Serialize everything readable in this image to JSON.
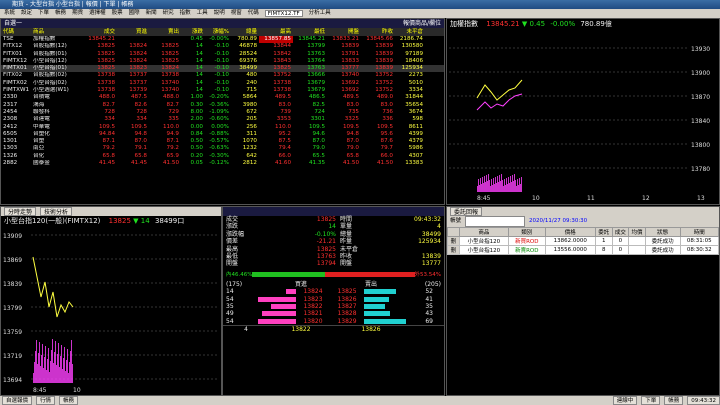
{
  "window": {
    "title": "期貨 - 大型台指 小型台指 | 報價 | 下單 | 帳務"
  },
  "menubar": {
    "items": [
      "系統",
      "設定",
      "下單",
      "帳務",
      "期貨",
      "選擇權",
      "股票",
      "國際",
      "新聞",
      "研究",
      "指數",
      "工具",
      "說明",
      "視窗"
    ],
    "symbol_label": "代碼",
    "symbol_value": "FIMTX12.TF",
    "analysis_label": "分析工具"
  },
  "quote": {
    "title": "自選一",
    "subtitle": "報價商品/欄位",
    "headers": [
      "代碼",
      "商品",
      "成交",
      "買進",
      "賣出",
      "漲跌",
      "漲幅%",
      "總量",
      "最高",
      "最低",
      "開盤",
      "昨收",
      "未平倉"
    ],
    "rows": [
      [
        "TSE",
        "加權指數",
        "13845.21",
        "",
        "",
        "0.45",
        "-0.00%",
        "780.89",
        "13857.85",
        "13845.21",
        "13833.21",
        "13845.66",
        "2186.74"
      ],
      [
        "FITX12",
        "台股指數(12)",
        "13825",
        "13824",
        "13825",
        "14",
        "-0.10",
        "46878",
        "13844",
        "13799",
        "13839",
        "13839",
        "130580"
      ],
      [
        "FITX01",
        "台股指數(01)",
        "13825",
        "13824",
        "13825",
        "14",
        "-0.10",
        "28524",
        "13842",
        "13763",
        "13781",
        "13839",
        "97189"
      ],
      [
        "FIMTX12",
        "小型台指(12)",
        "13825",
        "13824",
        "13825",
        "14",
        "-0.10",
        "69376",
        "13843",
        "13764",
        "13833",
        "13839",
        "18406"
      ],
      [
        "FIMTX01",
        "小型台指(01)",
        "13825",
        "13823",
        "13824",
        "14",
        "-0.10",
        "38499",
        "13825",
        "13763",
        "13777",
        "13839",
        "125934"
      ],
      [
        "FITX02",
        "台股指數(02)",
        "13738",
        "13737",
        "13738",
        "14",
        "-0.10",
        "480",
        "13752",
        "13666",
        "13740",
        "13752",
        "2273"
      ],
      [
        "FIMTX02",
        "小型台指(02)",
        "13738",
        "13737",
        "13740",
        "14",
        "-0.10",
        "240",
        "13738",
        "13679",
        "13692",
        "13752",
        "5010"
      ],
      [
        "FIMTXW1",
        "小型週選(W1)",
        "13738",
        "13739",
        "13740",
        "14",
        "-0.10",
        "715",
        "13738",
        "13679",
        "13692",
        "13752",
        "3334"
      ],
      [
        "2330",
        "台積電",
        "488.0",
        "487.5",
        "488.0",
        "1.00",
        "-0.20%",
        "5864",
        "489.5",
        "486.5",
        "489.5",
        "489.0",
        "31844"
      ],
      [
        "2317",
        "鴻海",
        "82.7",
        "82.6",
        "82.7",
        "0.30",
        "-0.36%",
        "3980",
        "83.0",
        "82.5",
        "83.0",
        "83.0",
        "35654"
      ],
      [
        "2454",
        "聯發科",
        "728",
        "728",
        "729",
        "8.00",
        "-1.09%",
        "672",
        "739",
        "724",
        "735",
        "736",
        "3674"
      ],
      [
        "2308",
        "台達電",
        "334",
        "334",
        "335",
        "2.00",
        "-0.60%",
        "205",
        "3353",
        "3301",
        "3325",
        "336",
        "598"
      ],
      [
        "2412",
        "中華電",
        "109.5",
        "109.5",
        "110.0",
        "0.00",
        "0.00%",
        "256",
        "110.0",
        "109.5",
        "109.5",
        "109.5",
        "8611"
      ],
      [
        "6505",
        "台塑化",
        "94.84",
        "94.8",
        "94.9",
        "0.84",
        "-0.88%",
        "311",
        "95.2",
        "94.6",
        "94.8",
        "95.6",
        "4399"
      ],
      [
        "1301",
        "台塑",
        "87.1",
        "87.0",
        "87.1",
        "0.50",
        "-0.57%",
        "1070",
        "87.5",
        "87.0",
        "87.0",
        "87.6",
        "4379"
      ],
      [
        "1303",
        "南亞",
        "79.2",
        "79.1",
        "79.2",
        "0.50",
        "-0.63%",
        "1232",
        "79.4",
        "79.0",
        "79.0",
        "79.7",
        "5986"
      ],
      [
        "1326",
        "台化",
        "65.8",
        "65.8",
        "65.9",
        "0.20",
        "-0.30%",
        "642",
        "66.0",
        "65.5",
        "65.8",
        "66.0",
        "4307"
      ],
      [
        "2882",
        "國泰金",
        "41.45",
        "41.45",
        "41.50",
        "0.05",
        "-0.12%",
        "2812",
        "41.60",
        "41.35",
        "41.50",
        "41.50",
        "13383"
      ]
    ]
  },
  "mini_chart": {
    "title": "加權指數",
    "price": "13845.21",
    "change": "0.45",
    "pct": "-0.00%",
    "volume": "780.89億",
    "y_ticks": [
      "13930",
      "13900",
      "13870",
      "13840",
      "13800",
      "13780"
    ],
    "x_ticks": [
      "8:45",
      "10",
      "11",
      "12",
      "13"
    ]
  },
  "tick_chart": {
    "tab1": "分時走勢",
    "tab2": "技術分析",
    "title": "小型台指120(一般)(FIMTX12)",
    "price": "13825",
    "change": "14",
    "volume": "38499口",
    "y_ticks": [
      "13909",
      "13869",
      "13839",
      "13799",
      "13759",
      "13719",
      "13694"
    ],
    "x_ticks": [
      "8:45",
      "10"
    ],
    "vol_ticks": [
      "50000",
      "25000"
    ]
  },
  "detail": {
    "rows": [
      {
        "l": "成交",
        "v": "13825",
        "l2": "時間",
        "v2": "09:43:32"
      },
      {
        "l": "漲跌",
        "v": "14",
        "l2": "單量",
        "v2": "4"
      },
      {
        "l": "漲跌幅",
        "v": "-0.10%",
        "l2": "總量",
        "v2": "38499"
      },
      {
        "l": "價差",
        "v": "-21.21",
        "l2": "昨量",
        "v2": "125934"
      },
      {
        "l": "最高",
        "v": "13825",
        "l2": "未平倉",
        "v2": ""
      },
      {
        "l": "最低",
        "v": "13763",
        "l2": "昨收",
        "v2": "13839"
      },
      {
        "l": "開盤",
        "v": "13794",
        "l2": "開盤",
        "v2": "13777"
      }
    ],
    "bar_left": "內46.46%",
    "bar_right": "外53.54%",
    "depth_head": {
      "left": "(175)",
      "mid1": "買進",
      "mid2": "賣出",
      "right": "(205)"
    },
    "depth": [
      {
        "bq": "14",
        "bp": "13824",
        "sp": "13825",
        "sq": "52"
      },
      {
        "bq": "54",
        "bp": "13823",
        "sp": "13826",
        "sq": "41"
      },
      {
        "bq": "35",
        "bp": "13822",
        "sp": "13827",
        "sq": "35"
      },
      {
        "bq": "49",
        "bp": "13821",
        "sp": "13828",
        "sq": "43"
      },
      {
        "bq": "54",
        "bp": "13820",
        "sp": "13829",
        "sq": "69"
      }
    ],
    "foot": {
      "a": "4",
      "b": "13822",
      "c": "13826"
    }
  },
  "order": {
    "tab_label": "委託回報",
    "account_label": "帳號",
    "date_label": "2020/11/27 09:30:30",
    "headers": [
      "",
      "商品",
      "類別",
      "價格",
      "委託",
      "成交",
      "均價",
      "狀態",
      "時間"
    ],
    "rows": [
      {
        "act": "刪",
        "item": "小型台指120",
        "type": "新買ROD",
        "price": "13862.0000",
        "qty": "1",
        "fill": "0",
        "avg": "",
        "status": "委託成功",
        "time": "08:31:05"
      },
      {
        "act": "刪",
        "item": "小型台指120",
        "type": "新賣ROD",
        "price": "13556.0000",
        "qty": "8",
        "fill": "0",
        "avg": "",
        "status": "委託成功",
        "time": "08:30:32"
      }
    ]
  },
  "status": {
    "tabs": [
      "自選報價",
      "行情",
      "帳務"
    ],
    "right": [
      "連線中",
      "下單",
      "帳務",
      "09:43:32"
    ]
  }
}
